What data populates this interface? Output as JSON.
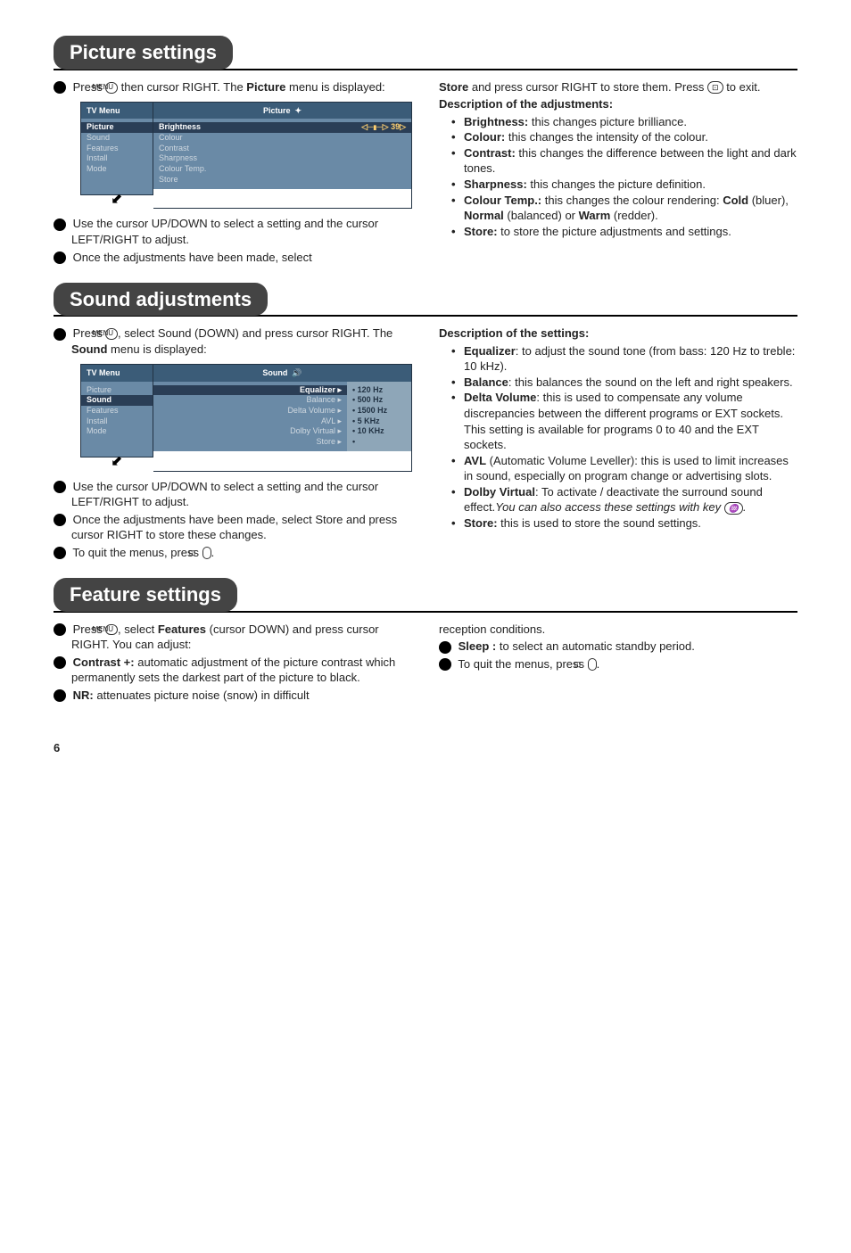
{
  "picture": {
    "heading": "Picture settings",
    "step1a": "Press ",
    "menu_key": "MENU",
    "step1b": " then cursor RIGHT. The ",
    "step1c": "Picture",
    "step1d": " menu is displayed:",
    "diagram": {
      "left_title": "TV Menu",
      "left_items": [
        "Picture",
        "Sound",
        "Features",
        "Install",
        "Mode"
      ],
      "right_title": "Picture",
      "right_active": "Brightness",
      "right_value": "39",
      "right_items": [
        "Colour",
        "Contrast",
        "Sharpness",
        "Colour Temp.",
        "Store"
      ]
    },
    "step2": "Use the cursor UP/DOWN to select a setting and the cursor LEFT/RIGHT to adjust.",
    "step3": "Once the adjustments have been made, select",
    "right_top1a": "Store",
    "right_top1b": " and press cursor RIGHT to store them. Press ",
    "right_top1c": " to exit.",
    "desc_heading": "Description of the adjustments:",
    "desc": {
      "brightness_l": "Brightness:",
      "brightness_t": " this changes picture brilliance.",
      "colour_l": "Colour:",
      "colour_t": " this changes the intensity of the colour.",
      "contrast_l": "Contrast:",
      "contrast_t": " this changes the difference between the light and dark tones.",
      "sharpness_l": "Sharpness:",
      "sharpness_t": " this changes the picture definition.",
      "ctemp_l": "Colour Temp.:",
      "ctemp_t1": " this changes the colour rendering: ",
      "ctemp_cold": "Cold",
      "ctemp_t2": " (bluer), ",
      "ctemp_normal": "Normal",
      "ctemp_t3": " (balanced) or ",
      "ctemp_warm": "Warm",
      "ctemp_t4": " (redder).",
      "store_l": "Store:",
      "store_t": " to store the picture adjustments and settings."
    }
  },
  "sound": {
    "heading": "Sound adjustments",
    "step1a": "Press ",
    "step1b": ", select Sound (DOWN) and press cursor RIGHT. The ",
    "step1c": "Sound",
    "step1d": " menu is displayed:",
    "diagram": {
      "left_title": "TV Menu",
      "left_items": [
        "Picture",
        "Sound",
        "Features",
        "Install",
        "Mode"
      ],
      "right_title": "Sound",
      "left_col_active": "Equalizer",
      "left_col": [
        "Balance",
        "Delta Volume",
        "AVL",
        "Dolby Virtual",
        "Store"
      ],
      "right_col": [
        "120 Hz",
        "500 Hz",
        "1500 Hz",
        "5 KHz",
        "10 KHz"
      ]
    },
    "step2": "Use the cursor UP/DOWN to select a setting and the cursor LEFT/RIGHT to adjust.",
    "step3": "Once the adjustments have been made, select Store and press cursor RIGHT to store these changes.",
    "step4a": "To quit the menus, press ",
    "desc_heading": "Description of the settings:",
    "desc": {
      "eq_l": "Equalizer",
      "eq_t": ": to adjust the sound tone (from bass: 120 Hz to treble: 10 kHz).",
      "bal_l": "Balance",
      "bal_t": ": this balances the sound on the left and right speakers.",
      "dv_l": "Delta Volume",
      "dv_t": ": this is used to compensate any volume discrepancies between the different programs or EXT sockets. This setting is available for programs 0 to 40 and the EXT sockets.",
      "avl_l": "AVL",
      "avl_t": " (Automatic Volume Leveller): this is used to limit increases in sound, especially on program change or advertising slots.",
      "dolby_l": "Dolby Virtual",
      "dolby_t1": ": To activate / deactivate the surround sound effect.",
      "dolby_it": "You can also access these settings with key ",
      "store_l": "Store:",
      "store_t": " this is used to store the sound settings."
    }
  },
  "feature": {
    "heading": "Feature settings",
    "step1a": "Press ",
    "step1b": ", select ",
    "step1c": "Features",
    "step1d": " (cursor DOWN) and press cursor RIGHT. You can adjust:",
    "step2_l": "Contrast +:",
    "step2_t": " automatic adjustment of the picture contrast which permanently sets the darkest part of the picture to black.",
    "step3_l": "NR:",
    "step3_t": " attenuates picture noise (snow) in difficult",
    "right_top": "reception conditions.",
    "step4_l": "Sleep :",
    "step4_t": " to select an automatic standby period.",
    "step5a": "To quit the menus, press "
  },
  "page": "6"
}
